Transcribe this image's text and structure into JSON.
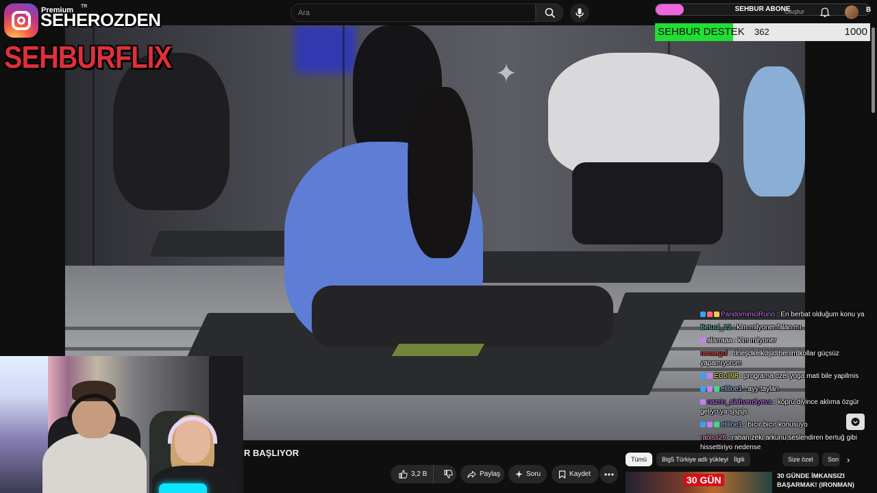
{
  "overlay": {
    "yt_premium": "Premium",
    "yt_trademark": "TR",
    "ig_handle": "SEHEROZDEN",
    "brand": "SEHBURFLIX"
  },
  "search": {
    "placeholder": "Ara"
  },
  "goals": {
    "abone_label": "SEHBUR ABONE",
    "abone_progress": 0.13,
    "destek_label": "SEHBUR DESTEK",
    "destek_current": "362",
    "destek_goal": "1000",
    "destek_progress": 0.362,
    "abone_color": "#ee66dd",
    "destek_color": "#22dd33"
  },
  "header_right": {
    "create_label": "Oluştur",
    "user_initial": "B"
  },
  "video": {
    "title_fragment": "R BAŞLIYOR",
    "likes": "3,2 B",
    "share_label": "Paylaş",
    "ask_label": "Soru",
    "save_label": "Kaydet"
  },
  "chat": [
    {
      "user": "PandomimciRuno",
      "color": "#c77dff",
      "badges": [
        "#36a3ff",
        "#ff6b6b",
        "#f5c84c"
      ],
      "text": "En berbat olduğum konu ya"
    },
    {
      "user": "Betuul_13",
      "color": "#7bdcb5",
      "badges": [],
      "text": "kim milyoner falan mı"
    },
    {
      "user": "alarraaa",
      "color": "#ffffff",
      "badges": [
        "#c77dff"
      ],
      "text": "kim milyoner"
    },
    {
      "user": "nessagul",
      "color": "#ff4d4d",
      "badges": [],
      "text": "dneşdkelkdşld benim kollar güçsüz yapamıyorum"
    },
    {
      "user": "ECoIi98",
      "color": "#ffff66",
      "badges": [
        "#36a3ff",
        "#c77dff"
      ],
      "text": "programa ozel yoga mati bile yapilmis"
    },
    {
      "user": "elilloe1",
      "color": "#9dd3ff",
      "badges": [
        "#36a3ff",
        "#c77dff",
        "#3ddc84"
      ],
      "text": "ayy taylan"
    },
    {
      "user": "nazrin_alahverdiyeva",
      "color": "#c77dff",
      "badges": [
        "#c77dff"
      ],
      "text": "köprü diyince aklıma özgür geliyo ya sjsjsjs"
    },
    {
      "user": "elilloe1",
      "color": "#9dd3ff",
      "badges": [
        "#36a3ff",
        "#c77dff",
        "#3ddc84"
      ],
      "text": "bıcır bıcır konusuyo"
    },
    {
      "user": "rabiss26",
      "color": "#ff9ec4",
      "badges": [],
      "text": "raban zeki arkunu seslendiren bertuğ gibi hissettiriyo nedense"
    }
  ],
  "chips": {
    "all": "Tümü",
    "c2": "Big5 Türkiye adlı yükleyiciden",
    "c3": "İlgili",
    "c4": "Size özel",
    "c5": "Son"
  },
  "recommended": {
    "timer": "30 GÜN",
    "title": "30 GÜNDE İMKANSIZI BAŞARMAK! (IRONMAN)"
  }
}
